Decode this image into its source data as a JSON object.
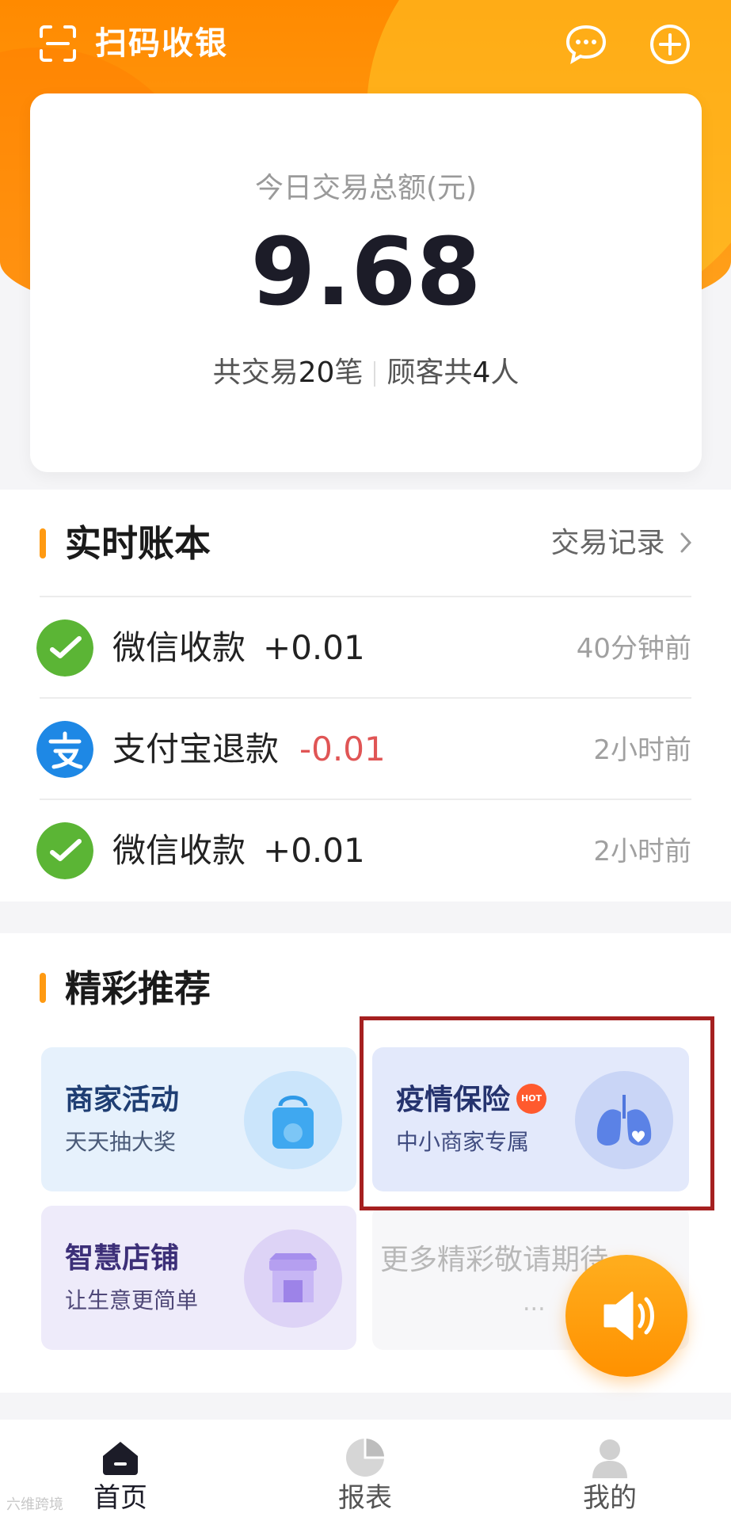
{
  "header": {
    "title": "扫码收银",
    "icons": [
      "scan-icon",
      "message-icon",
      "add-icon"
    ]
  },
  "summary": {
    "label": "今日交易总额(元)",
    "amount": "9.68",
    "trades_prefix": "共交易",
    "trades_count": "20",
    "trades_suffix": "笔",
    "customers_prefix": "顾客共",
    "customers_count": "4",
    "customers_suffix": "人"
  },
  "ledger": {
    "title": "实时账本",
    "records_link": "交易记录",
    "items": [
      {
        "icon": "wechat-pay-icon",
        "name": "微信收款",
        "amount": "+0.01",
        "time": "40分钟前",
        "color": "#222222"
      },
      {
        "icon": "alipay-icon",
        "name": "支付宝退款",
        "amount": "-0.01",
        "time": "2小时前",
        "color": "#e05555"
      },
      {
        "icon": "wechat-pay-icon",
        "name": "微信收款",
        "amount": "+0.01",
        "time": "2小时前",
        "color": "#222222"
      }
    ]
  },
  "recommend": {
    "title": "精彩推荐",
    "cards": [
      {
        "title": "商家活动",
        "subtitle": "天天抽大奖",
        "icon": "shopping-bag-icon"
      },
      {
        "title": "疫情保险",
        "subtitle": "中小商家专属",
        "badge": "HOT",
        "icon": "lungs-heart-icon"
      },
      {
        "title": "智慧店铺",
        "subtitle": "让生意更简单",
        "icon": "storefront-icon"
      },
      {
        "title": "更多精彩敬请期待",
        "subtitle": "..."
      }
    ]
  },
  "tabbar": {
    "items": [
      {
        "label": "首页",
        "icon": "home-icon",
        "active": true
      },
      {
        "label": "报表",
        "icon": "pie-chart-icon",
        "active": false
      },
      {
        "label": "我的",
        "icon": "user-icon",
        "active": false
      }
    ]
  },
  "watermark": "六维跨境",
  "colors": {
    "brand_orange": "#ff9a12",
    "income": "#222222",
    "refund": "#e05555",
    "wechat_green": "#5bb535",
    "alipay_blue": "#1e88e5"
  }
}
